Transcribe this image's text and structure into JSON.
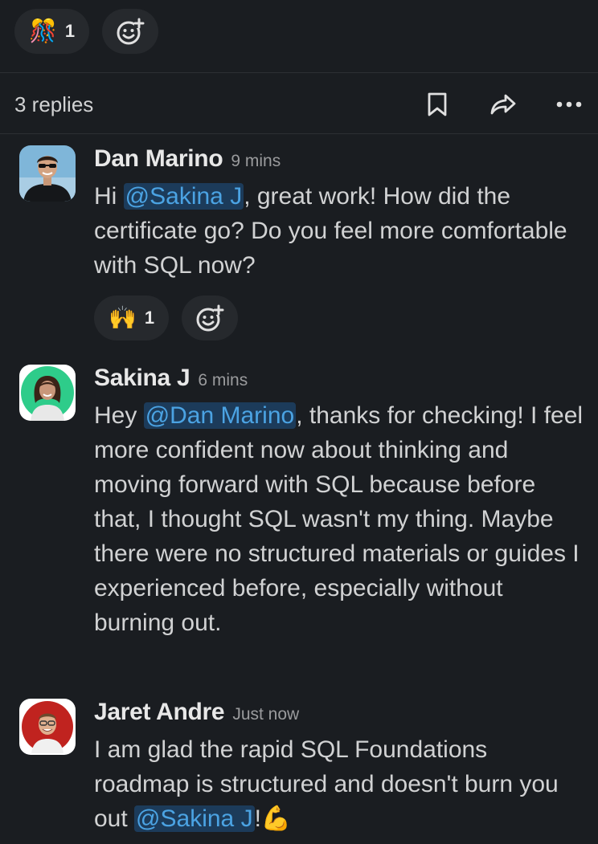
{
  "top_reactions": {
    "party_count": "1"
  },
  "thread": {
    "replies_label": "3 replies"
  },
  "messages": [
    {
      "author": "Dan Marino",
      "time": "9 mins",
      "text_before": "Hi ",
      "mention": "@Sakina J",
      "text_after": ", great work! How did the certificate go? Do you feel more comfortable with SQL now?",
      "reaction_count": "1"
    },
    {
      "author": "Sakina J",
      "time": "6 mins",
      "text_before": "Hey ",
      "mention": "@Dan Marino",
      "text_after": ", thanks for checking! I feel more confident now about thinking and moving forward with SQL because before that, I thought SQL wasn't my thing. Maybe there were no structured materials or guides I experienced before, especially without burning out."
    },
    {
      "author": "Jaret Andre",
      "time": "Just now",
      "text_before": "I am glad the rapid SQL Foundations roadmap is structured and doesn't burn you out ",
      "mention": "@Sakina J",
      "text_after": "!"
    }
  ],
  "icons": {
    "party_emoji": "🎊",
    "raised_hands_emoji": "🙌",
    "flexed_biceps_emoji": "💪"
  },
  "colors": {
    "background": "#1a1d21",
    "mention_bg": "#1c3b5a",
    "mention_fg": "#4ba3e3",
    "pill_bg": "#26292d"
  }
}
